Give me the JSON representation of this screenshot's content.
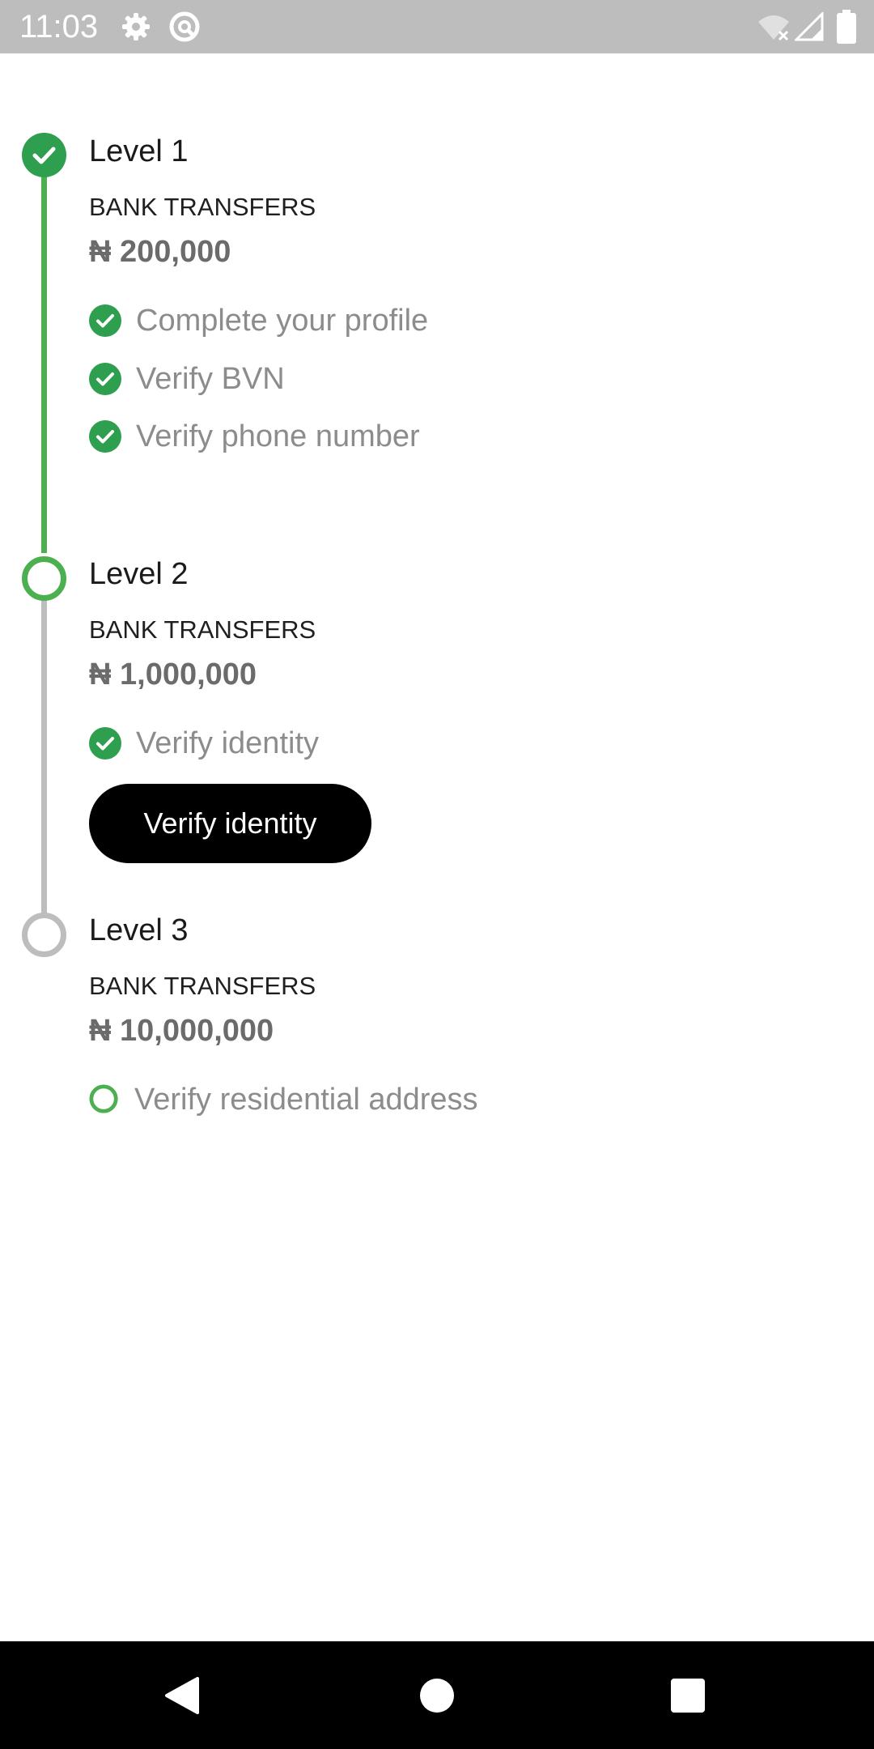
{
  "status_bar": {
    "time": "11:03",
    "icons": [
      "settings-icon",
      "at-sign-icon",
      "wifi-off-icon",
      "signal-icon",
      "battery-icon"
    ]
  },
  "colors": {
    "accent_green": "#2e9e4f",
    "track_green": "#4caf50",
    "track_gray": "#bdbdbd",
    "button_bg": "#000000"
  },
  "levels": [
    {
      "title": "Level 1",
      "status": "completed",
      "category": "BANK TRANSFERS",
      "limit": "₦ 200,000",
      "requirements": [
        {
          "label": "Complete your profile",
          "done": true
        },
        {
          "label": "Verify BVN",
          "done": true
        },
        {
          "label": "Verify phone number",
          "done": true
        }
      ]
    },
    {
      "title": "Level 2",
      "status": "current",
      "category": "BANK TRANSFERS",
      "limit": "₦ 1,000,000",
      "requirements": [
        {
          "label": "Verify identity",
          "done": true
        }
      ],
      "action_label": "Verify identity"
    },
    {
      "title": "Level 3",
      "status": "locked",
      "category": "BANK TRANSFERS",
      "limit": "₦ 10,000,000",
      "requirements": [
        {
          "label": "Verify residential address",
          "done": false
        }
      ]
    }
  ],
  "nav_bar": {
    "buttons": [
      "back-icon",
      "home-icon",
      "recents-icon"
    ]
  }
}
